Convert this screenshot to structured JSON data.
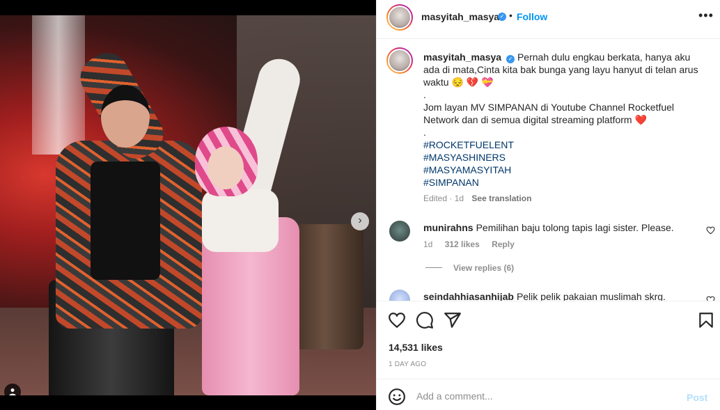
{
  "post": {
    "username": "masyitah_masya",
    "verified": true,
    "separator": "•",
    "follow_label": "Follow",
    "more_label": "•••",
    "image_count": 6,
    "active_image": 1
  },
  "caption": {
    "username": "masyitah_masya",
    "lines": [
      "Pernah dulu engkau berkata, hanya aku ada di mata,Cinta kita bak bunga yang layu hanyut di telan arus waktu 😔 💔 💝",
      ".",
      "Jom layan MV SIMPANAN di Youtube Channel Rocketfuel Network dan di semua digital streaming platform ❤️",
      "."
    ],
    "hashtags": [
      "#ROCKETFUELENT",
      "#MASYASHINERS",
      "#MASYAMASYITAH",
      "#SIMPANAN"
    ],
    "edited": "Edited · 1d",
    "see_translation": "See translation"
  },
  "comments": [
    {
      "username": "munirahns",
      "text": "Pemilihan baju tolong tapis lagi sister. Please.",
      "age": "1d",
      "likes": "312 likes",
      "reply": "Reply",
      "view_replies": "View replies (6)"
    },
    {
      "username": "seindahhiasanhijab",
      "text": "Pelik pelik pakaian muslimah skrg."
    }
  ],
  "likes": "14,531 likes",
  "time_ago": "1 DAY AGO",
  "composer": {
    "placeholder": "Add a comment...",
    "post_label": "Post"
  },
  "colors": {
    "follow": "#0095f6",
    "hashtag": "#00376b",
    "post_disabled": "#b2dffc",
    "verified": "#3897f0"
  },
  "icons": [
    "heart-icon",
    "comment-icon",
    "share-icon",
    "bookmark-icon",
    "emoji-icon",
    "more-icon",
    "chevron-right-icon",
    "user-tag-icon"
  ]
}
